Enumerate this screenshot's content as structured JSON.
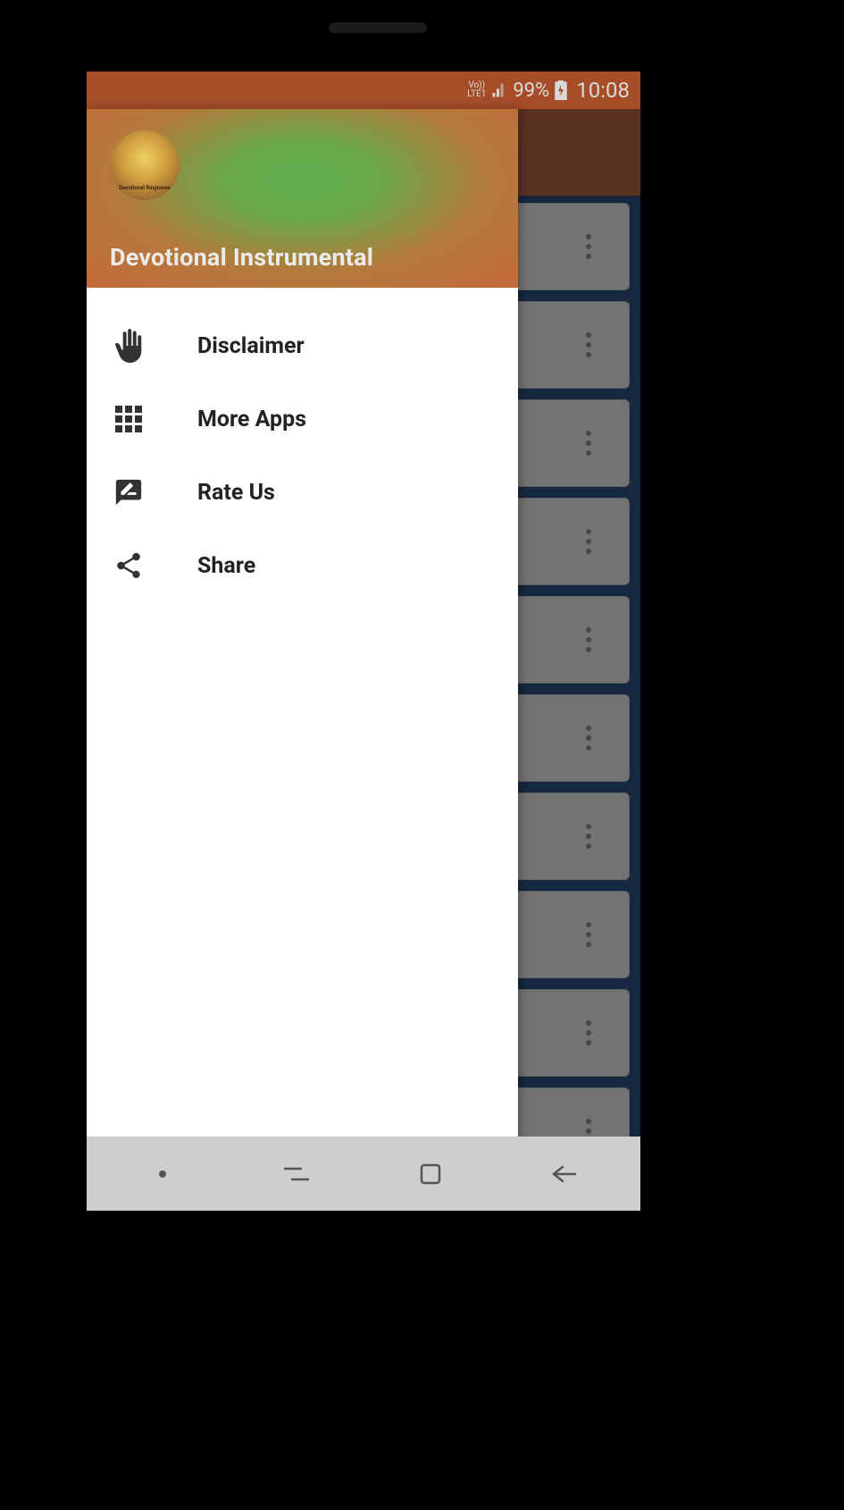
{
  "status_bar": {
    "network": "LTE1",
    "volte": "Vo))",
    "battery": "99%",
    "time": "10:08"
  },
  "drawer": {
    "title": "Devotional Instrumental",
    "avatar_label": "Devotional Ringtones",
    "items": [
      {
        "label": "Disclaimer",
        "icon": "hand"
      },
      {
        "label": "More Apps",
        "icon": "grid"
      },
      {
        "label": "Rate Us",
        "icon": "rate"
      },
      {
        "label": "Share",
        "icon": "share"
      }
    ]
  },
  "bg_card_count": 10
}
